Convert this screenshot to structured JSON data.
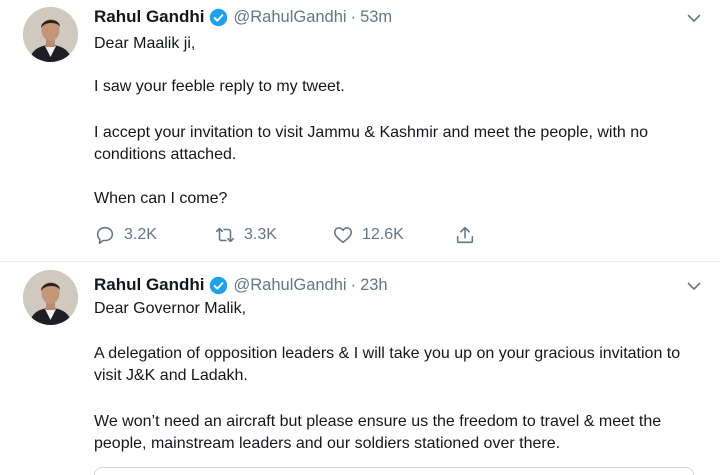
{
  "tweets": [
    {
      "author": {
        "name": "Rahul Gandhi",
        "handle": "@RahulGandhi",
        "separator": "·",
        "time": "53m"
      },
      "paragraphs": [
        "Dear Maalik ji,",
        "I saw your feeble reply to my tweet.",
        "I accept your invitation to visit Jammu & Kashmir and meet the people, with no conditions attached.",
        "When can I come?"
      ],
      "actions": {
        "replies": "3.2K",
        "retweets": "3.3K",
        "likes": "12.6K"
      }
    },
    {
      "author": {
        "name": "Rahul Gandhi",
        "handle": "@RahulGandhi",
        "separator": "·",
        "time": "23h"
      },
      "paragraphs": [
        "Dear Governor Malik,",
        "A delegation of opposition leaders & I will take you up on your gracious invitation to visit J&K and Ladakh.",
        "We won’t need an aircraft but please ensure us the freedom to travel & meet the people, mainstream leaders and our soldiers stationed over there."
      ]
    }
  ],
  "icons": {
    "verified": "verified-badge-icon",
    "menu": "chevron-down-icon",
    "reply": "reply-bubble-icon",
    "retweet": "retweet-icon",
    "like": "heart-icon",
    "share": "share-upload-icon"
  },
  "colors": {
    "verified": "#1da1f2",
    "secondary_text": "#657786",
    "divider": "#e6ecf0"
  }
}
